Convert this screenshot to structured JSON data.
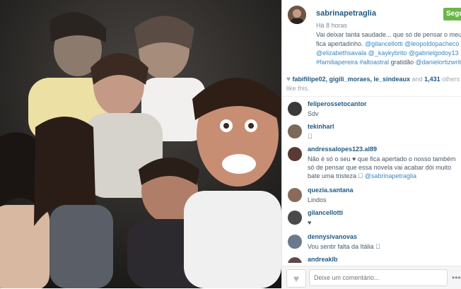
{
  "post": {
    "username": "sabrinapetraglia",
    "time": "Há 8 horas",
    "follow_label": "Seguir",
    "caption_text": "Vai deixar tanta saudade... que só de pensar o meu fica apertadinho.",
    "caption_tags": "@gilancellotti @leopoldopacheco @elizabethsavala @_kaykybrito @gabrielgodoy13 #familiapereira #altoastral",
    "caption_end": "gratidão",
    "caption_tag_end": "@danielortizwrit"
  },
  "likes": {
    "users": "fabifilipe02, gigili_moraes, le_sindeaux",
    "and": "and",
    "count": "1,431",
    "suffix": "others like this."
  },
  "comments": [
    {
      "user": "feliperossetocantor",
      "text": "Sdv"
    },
    {
      "user": "tekinharl",
      "text": "󾌳"
    },
    {
      "user": "andressalopes123.al89",
      "text": "Não é só o seu ♥ que fica apertado o nosso também só de pensar que essa novela vai acabar dói muito bate uma tristeza 󾌳 ",
      "link": "@sabrinapetraglia"
    },
    {
      "user": "quezia.santana",
      "text": "Lindos"
    },
    {
      "user": "gilancellotti",
      "text": "♥"
    },
    {
      "user": "dennysivanovas",
      "text": "Vou sentir falta da Itália 󾌳"
    },
    {
      "user": "andreaklb",
      "text": ""
    }
  ],
  "comment_box": {
    "placeholder": "Deixe um comentário...",
    "more": "•••"
  },
  "colors": {
    "accent": "#1f5a84",
    "link": "#3b88c3",
    "follow": "#6bb649"
  },
  "icons": [
    "heart-icon",
    "like-heart-icon",
    "more-icon"
  ]
}
